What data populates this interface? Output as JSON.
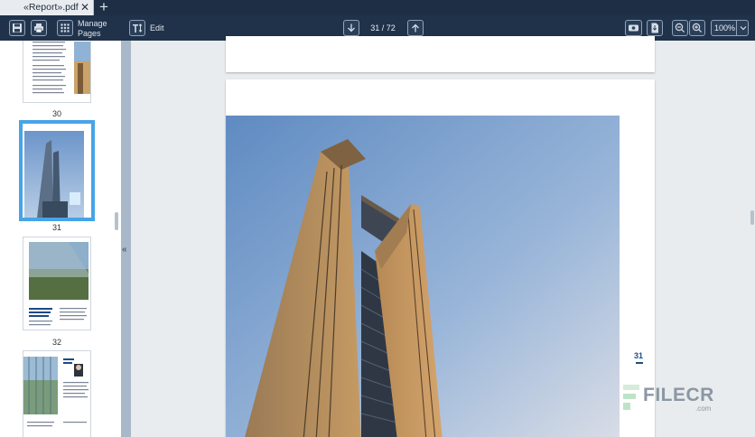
{
  "tab": {
    "title": "«Report».pdf",
    "close": "✕",
    "add": "+"
  },
  "toolbar": {
    "manage_line1": "Manage",
    "manage_line2": "Pages",
    "edit_label": "Edit",
    "page_indicator": "31 / 72",
    "zoom": "100%"
  },
  "sidebar": {
    "thumbs": [
      {
        "number": "30"
      },
      {
        "number": "31",
        "selected": true
      },
      {
        "number": "32"
      }
    ]
  },
  "viewer": {
    "page_label": "31"
  },
  "watermark": {
    "brand": "FILECR",
    "domain": ".com"
  },
  "colors": {
    "toolbar": "#20324a",
    "tabbar": "#1e2f45",
    "selection": "#47a4e6",
    "page_number": "#1c4f86"
  }
}
